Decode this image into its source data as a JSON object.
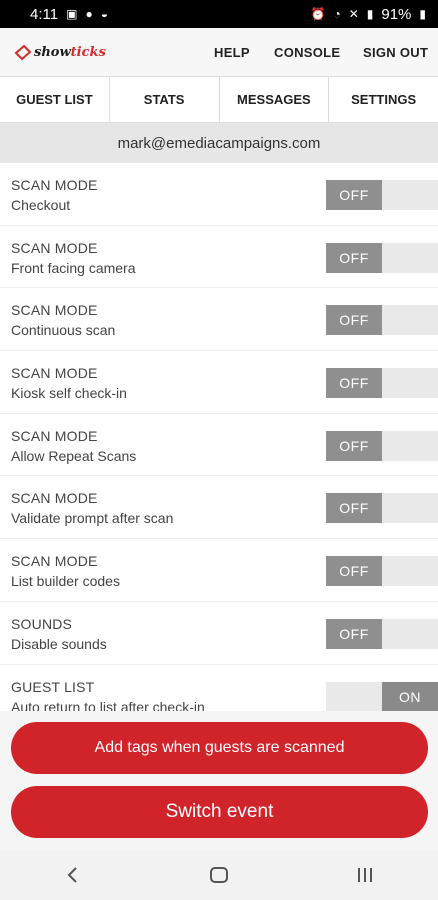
{
  "status_bar": {
    "time": "4:11",
    "battery": "91%"
  },
  "app": {
    "logo_text_1": "show",
    "logo_text_2": "ticks",
    "nav": {
      "help": "HELP",
      "console": "CONSOLE",
      "sign_out": "SIGN OUT"
    }
  },
  "tabs": [
    "GUEST LIST",
    "STATS",
    "MESSAGES",
    "SETTINGS"
  ],
  "account_email": "mark@emediacampaigns.com",
  "settings": [
    {
      "category": "SCAN MODE",
      "label": "Checkout",
      "state": "OFF"
    },
    {
      "category": "SCAN MODE",
      "label": "Front facing camera",
      "state": "OFF"
    },
    {
      "category": "SCAN MODE",
      "label": "Continuous scan",
      "state": "OFF"
    },
    {
      "category": "SCAN MODE",
      "label": "Kiosk self check-in",
      "state": "OFF"
    },
    {
      "category": "SCAN MODE",
      "label": "Allow Repeat Scans",
      "state": "OFF"
    },
    {
      "category": "SCAN MODE",
      "label": "Validate prompt after scan",
      "state": "OFF"
    },
    {
      "category": "SCAN MODE",
      "label": "List builder codes",
      "state": "OFF"
    },
    {
      "category": "SOUNDS",
      "label": "Disable sounds",
      "state": "OFF"
    },
    {
      "category": "GUEST LIST",
      "label": "Auto return to list after check-in",
      "state": "ON"
    }
  ],
  "buttons": {
    "add_tags": "Add tags when guests are scanned",
    "switch_event": "Switch event"
  },
  "colors": {
    "brand_red": "#d1232a",
    "toggle_knob": "#8f8f8f"
  }
}
